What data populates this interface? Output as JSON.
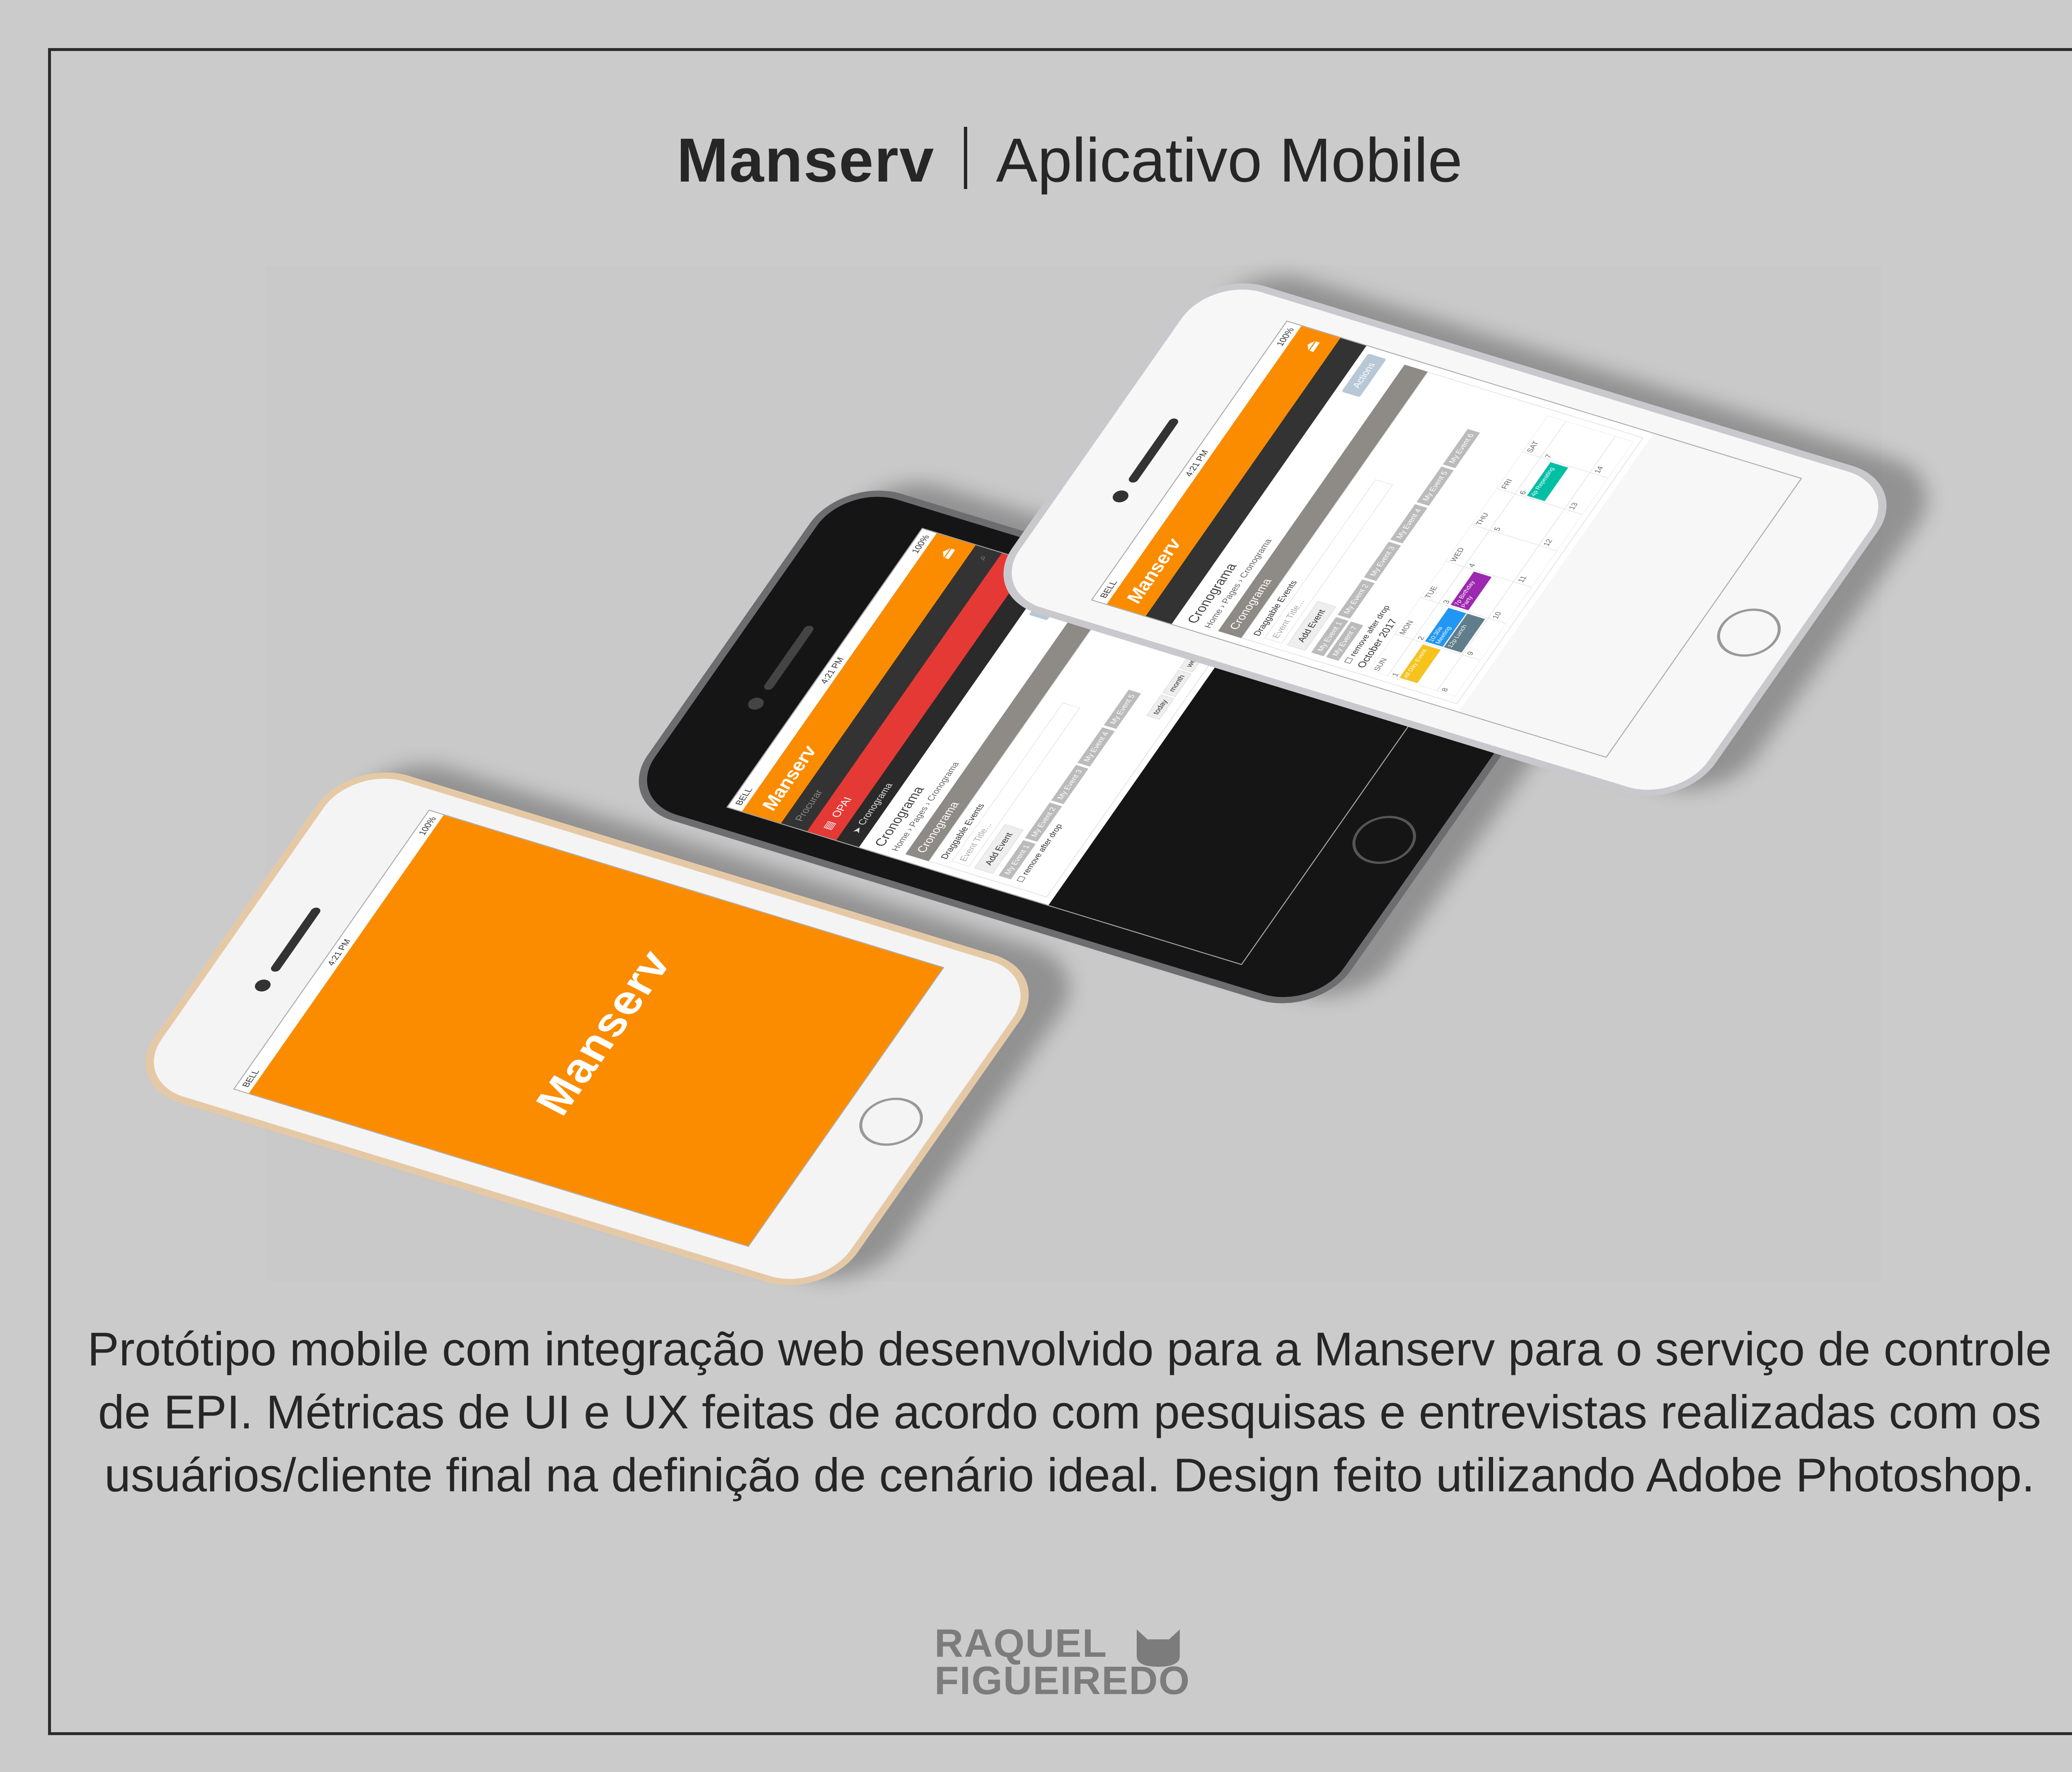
{
  "header": {
    "brand": "Manserv",
    "subtitle": "Aplicativo Mobile"
  },
  "phones": {
    "status_carrier": "BELL",
    "status_time": "4:21 PM",
    "status_battery": "100%",
    "logo_text": "Manserv",
    "search_placeholder": "Procurar",
    "menu_opai": "OPAI",
    "menu_cronograma": "Cronograma",
    "actions_button": "Actions",
    "page_title": "Cronograma",
    "breadcrumb_home": "Home",
    "breadcrumb_pages": "Pages",
    "breadcrumb_current": "Cronograma",
    "panel_title": "Cronograma",
    "draggable_label": "Draggable Events",
    "event_placeholder": "Event Title...",
    "add_event_button": "Add Event",
    "chips": [
      "My Event 1",
      "My Event 2",
      "My Event 3",
      "My Event 4",
      "My Event 5",
      "My Event 6",
      "My Event 7"
    ],
    "remove_after_drop": "remove after drop",
    "views": [
      "today",
      "month",
      "week",
      "day"
    ],
    "calendar_month": "October 2017",
    "weekdays": [
      "SUN",
      "MON",
      "TUE",
      "WED",
      "THU",
      "FRI",
      "SAT"
    ],
    "days": [
      "1",
      "2",
      "3",
      "4",
      "5",
      "6",
      "7",
      "8",
      "9",
      "10",
      "11",
      "12",
      "13",
      "14"
    ],
    "events": [
      {
        "label": "All Day Event",
        "color": "#f6c31c"
      },
      {
        "label": "10:30a Meeting",
        "color": "#2196f3"
      },
      {
        "label": "7p Birthday Party",
        "color": "#9c27b0"
      },
      {
        "label": "12p Lunch",
        "color": "#607d8b"
      },
      {
        "label": "4p Repeating",
        "color": "#00bfa5"
      }
    ]
  },
  "description": "Protótipo mobile com integração web desenvolvido para a Manserv para o serviço de controle de EPI. Métricas de UI e UX feitas de acordo com pesquisas e entrevistas realizadas com os usuários/cliente final na definição de cenário ideal. Design feito utilizando Adobe Photoshop.",
  "signature": {
    "line1": "RAQUEL",
    "line2": "FIGUEIREDO"
  },
  "colors": {
    "brand_orange": "#fb8c00",
    "accent_red": "#e53935",
    "background": "#cbcbcb"
  }
}
